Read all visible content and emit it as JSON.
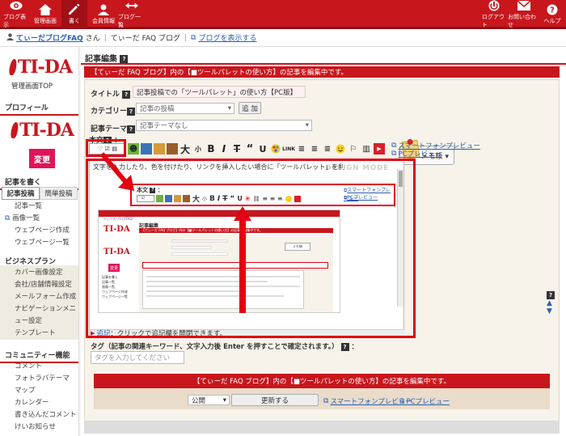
{
  "nav_left": [
    {
      "label": "ブログ表示",
      "icon": "eye"
    },
    {
      "label": "管理画面",
      "icon": "home"
    },
    {
      "label": "書く",
      "icon": "pencil"
    },
    {
      "label": "会員情報",
      "icon": "user"
    },
    {
      "label": "ブログ一覧",
      "icon": "arrows"
    }
  ],
  "nav_right": [
    {
      "label": "ログアウト",
      "icon": "power"
    },
    {
      "label": "お問い合わせ",
      "icon": "mail"
    },
    {
      "label": "ヘルプ",
      "icon": "help"
    }
  ],
  "userbar": {
    "blog_name": "てぃーだブログFAQ",
    "san": "さん",
    "blog_title": "てぃーだ FAQ ブログ",
    "view_link": "ブログを表示する"
  },
  "sidebar": {
    "logo_text": "TI-DA",
    "admin_top": "管理画面TOP",
    "profile_head": "プロフィール",
    "change_btn": "変更",
    "write_head": "記事を書く",
    "tab_post": "記事投稿",
    "tab_simple": "簡単投稿",
    "list_items": [
      "記事一覧",
      "画像一覧",
      "ウェブページ作成",
      "ウェブページ一覧"
    ],
    "business_head": "ビジネスプラン",
    "business_items": [
      "カバー画像設定",
      "会社/店舗情報設定",
      "メールフォーム作成",
      "ナビゲーションメニュー設定",
      "テンプレート"
    ],
    "community_head": "コミュニティー機能",
    "community_items": [
      "コメント",
      "フォトラバテーマ",
      "マップ",
      "カレンダー",
      "書き込んだコメント",
      "けいお知らせ"
    ]
  },
  "main": {
    "heading": "記事編集",
    "band_text": "【てぃーだ FAQ ブログ】内の【■ツールパレットの使い方】の記事を編集中です。",
    "title_label": "タイトル",
    "title_value": "記事投稿での「ツールパレット」の使い方【PC版】",
    "category_label": "カテゴリー",
    "category_value": "記事の投稿",
    "add_btn": "追 加",
    "memo_btn": "メモ帳 ▾",
    "theme_label": "記事テーマ",
    "theme_value": "記事テーマなし",
    "body_label": "本文",
    "smartphone_preview": "スマートフォンプレビュー",
    "pc_preview": "PCプレビュー",
    "design_mode": "DESIGN MODE",
    "editor_line": "文字を入力したり、色を付けたり、リンクを挿入したい場合に「ツールパレット」を利用します。",
    "appendix_link": "追記",
    "appendix_text": "：クリックで追記欄を開閉できます。",
    "tag_label": "タグ（記事の関連キーワード、文字入力後 Enter を押すことで確定されます。）",
    "tag_placeholder": "タグを入力してください",
    "bottom_band": "【てぃーだ FAQ ブログ】内の【■ツールパレットの使い方】の記事を編集中です。",
    "status_value": "公開",
    "update_btn": "更新する",
    "bottom_smart": "スマートフォンプレビュー",
    "bottom_pc": "PCプレビュー"
  },
  "inner": {
    "body_label": "本文",
    "smart": "スマートフォンプレビュー",
    "pc": "PCプレビュー",
    "mini_blog": "てぃーだブログFAQ",
    "mini_band": "【てぃーだ FAQ ブログ】内の【■ツールパレットの使い方】の記事を編集中です。",
    "mini_heading": "記事編集",
    "mini_change": "変更",
    "mini_memo": "メモ帳",
    "mini_side": [
      "記事を書く",
      "記事一覧",
      "画像一覧",
      "ウェブページ作成",
      "ウェブページ一覧"
    ]
  },
  "colors": {
    "brand_red": "#c8161d",
    "highlight_red": "#e30012",
    "link_blue": "#2a5fb0"
  }
}
